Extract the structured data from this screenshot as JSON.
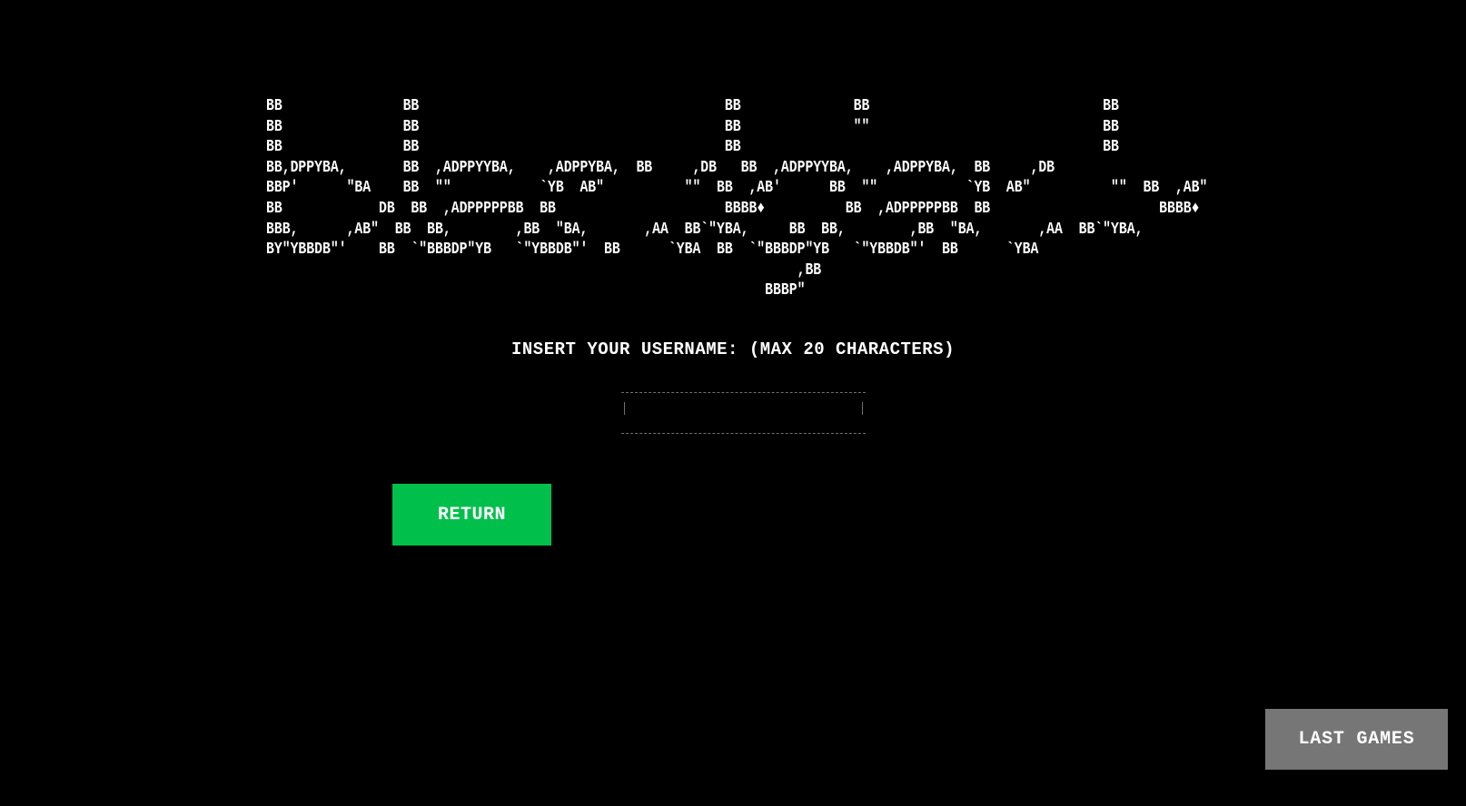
{
  "logo": {
    "ascii_art": "BB               BB                                      BB              BB                             BB\nBB               BB                                      BB              \"\"                             BB\nBB               BB                                      BB                                             BB\nBB,DPPYBA,       BB  ,ADPPYYBA,    ,ADPPYBA,  BB     ,DB   BB  ,ADPPYYBA,    ,ADPPYBA,  BB     ,DB\nBBP'      \"BA    BB  \"\"           `YB  AB\"          \"\"  BB  ,AB'      BB  \"\"           `YB  AB\"          \"\"  BB  ,AB\"\nBB            DB  BB  ,ADPPPPPBB  BB                     BBBB♦          BB  ,ADPPPPPBB  BB                     BBBB♦\nBBB,      ,AB\"  BB  BB,        ,BB  \"BA,       ,AA  BB`\"YBA,     BB  BB,        ,BB  \"BA,       ,AA  BB`\"YBA,\nBY\"YBBDB\"'    BB  `\"BBBDP\"YB   `\"YBBDB\"'  BB      `YBA  BB  `\"BBBDP\"YB   `\"YBBDB\"'  BB      `YBA\n                                                                  ,BB\n                                                              BBBP\""
  },
  "prompt": {
    "text": "INSERT YOUR USERNAME: (MAX 20 CHARACTERS)"
  },
  "username": {
    "value": "",
    "placeholder": ""
  },
  "buttons": {
    "return_label": "RETURN",
    "last_games_label": "LAST GAMES"
  },
  "colors": {
    "background": "#000000",
    "text": "#ffffff",
    "return_button": "#00c04b",
    "last_games_button": "#767676",
    "input_border": "#6f6f6f"
  }
}
